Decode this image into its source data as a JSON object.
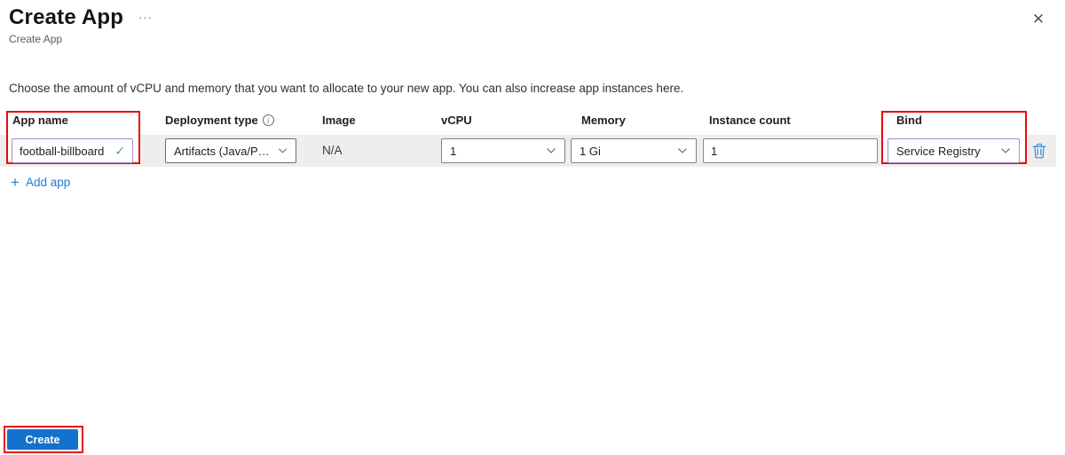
{
  "header": {
    "title": "Create App",
    "subtitle": "Create App",
    "more_glyph": "···",
    "close_glyph": "✕"
  },
  "description": "Choose the amount of vCPU and memory that you want to allocate to your new app. You can also increase app instances here.",
  "form": {
    "app_name": {
      "label": "App name",
      "value": "football-billboard",
      "valid_glyph": "✓"
    },
    "deployment_type": {
      "label": "Deployment type",
      "value": "Artifacts (Java/Poly...",
      "info_glyph": "i"
    },
    "image": {
      "label": "Image",
      "value": "N/A"
    },
    "vcpu": {
      "label": "vCPU",
      "value": "1"
    },
    "memory": {
      "label": "Memory",
      "value": "1 Gi"
    },
    "instance_count": {
      "label": "Instance count",
      "value": "1"
    },
    "bind": {
      "label": "Bind",
      "value": "Service Registry"
    },
    "add_app_label": "Add app",
    "add_app_glyph": "+"
  },
  "footer": {
    "create_label": "Create"
  },
  "colors": {
    "annotation_red": "#e90b0b",
    "primary_button_blue": "#1372cd",
    "link_blue": "#2579d6",
    "valid_green": "#52a852",
    "trash_blue": "#4a90d9",
    "focus_purple": "#a98bc9",
    "row_strip_gray": "#efeeed"
  }
}
